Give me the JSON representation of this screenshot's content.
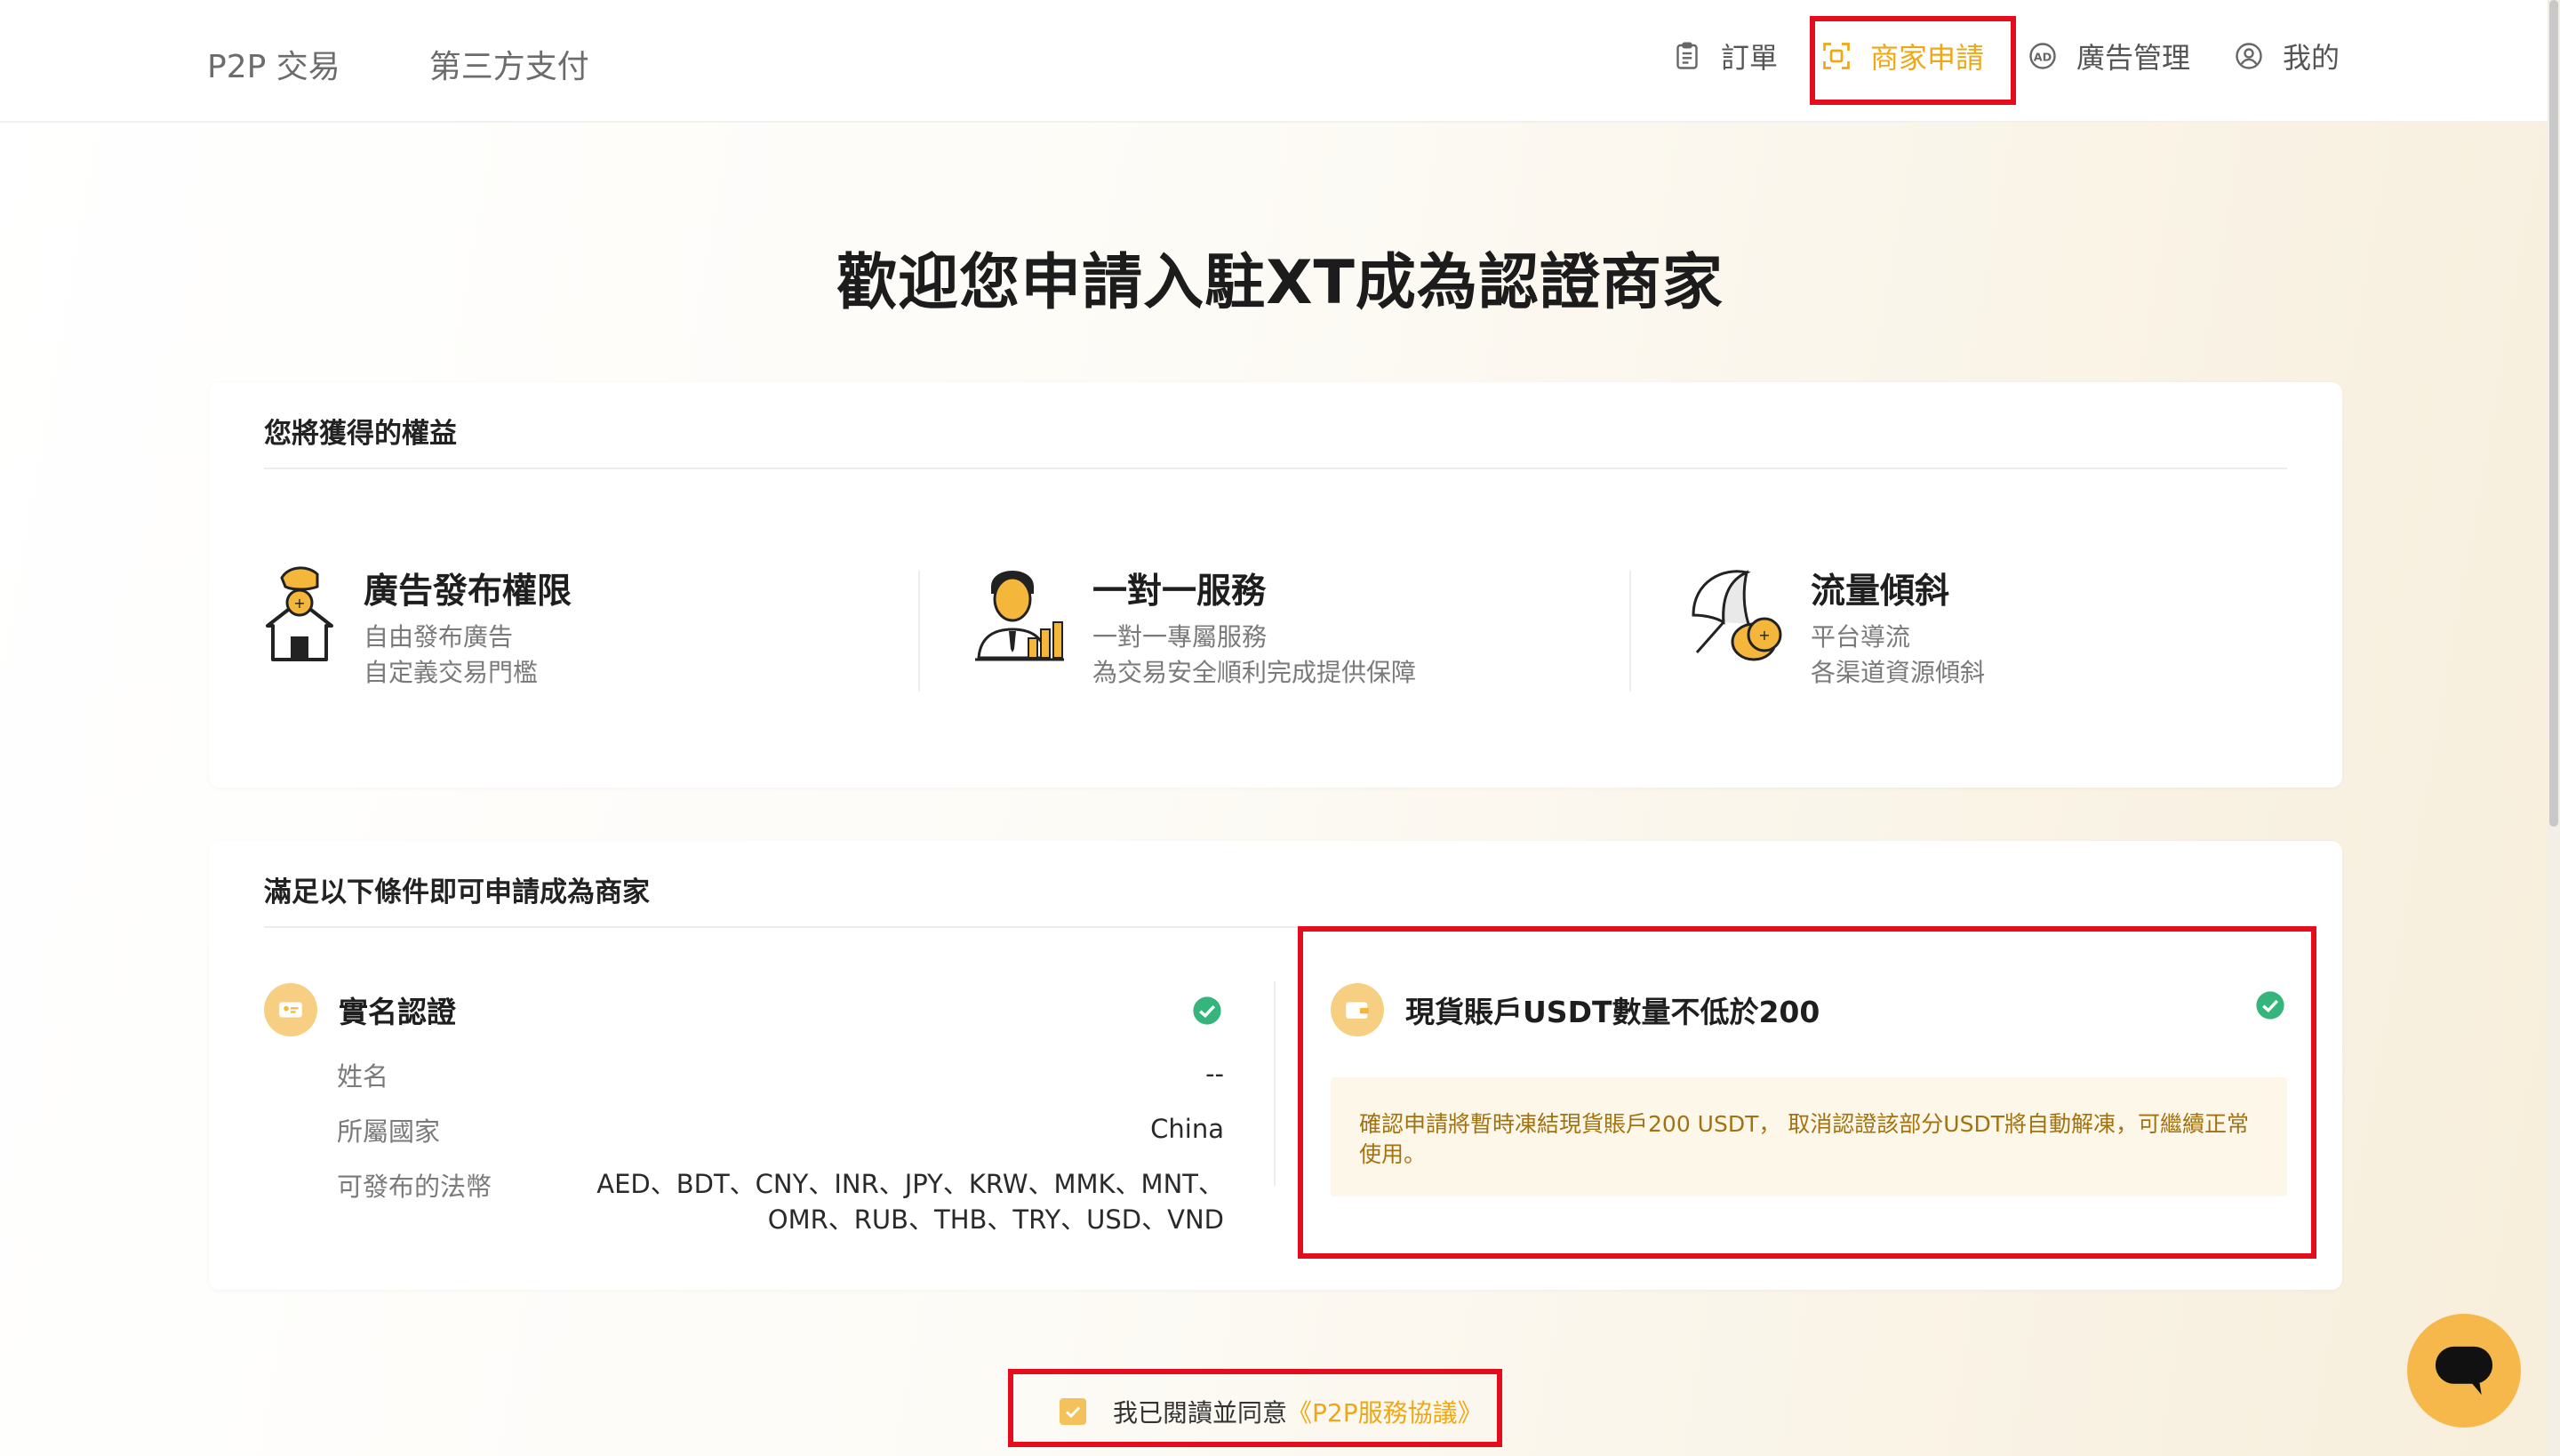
{
  "header": {
    "nav_left": [
      "P2P 交易",
      "第三方支付"
    ],
    "nav_right": [
      {
        "label": "訂單",
        "icon": "clipboard-icon"
      },
      {
        "label": "商家申請",
        "icon": "merchant-icon",
        "active": true
      },
      {
        "label": "廣告管理",
        "icon": "ad-icon"
      },
      {
        "label": "我的",
        "icon": "user-icon"
      }
    ],
    "accent_color": "#f0a714"
  },
  "page_title": "歡迎您申請入駐XT成為認證商家",
  "benefits": {
    "title": "您將獲得的權益",
    "items": [
      {
        "title": "廣告發布權限",
        "lines": [
          "自由發布廣告",
          "自定義交易門檻"
        ],
        "icon": "house-hand-icon"
      },
      {
        "title": "一對一服務",
        "lines": [
          "一對一專屬服務",
          "為交易安全順利完成提供保障"
        ],
        "icon": "agent-icon"
      },
      {
        "title": "流量傾斜",
        "lines": [
          "平台導流",
          "各渠道資源傾斜"
        ],
        "icon": "umbrella-coin-icon"
      }
    ]
  },
  "conditions": {
    "title": "滿足以下條件即可申請成為商家",
    "kyc": {
      "title": "實名認證",
      "rows": [
        {
          "label": "姓名",
          "value": "--"
        },
        {
          "label": "所屬國家",
          "value": "China"
        },
        {
          "label": "可發布的法幣",
          "value_lines": [
            "AED、BDT、CNY、INR、JPY、KRW、MMK、MNT、",
            "OMR、RUB、THB、TRY、USD、VND"
          ]
        }
      ]
    },
    "balance": {
      "title": "現貨賬戶USDT數量不低於200",
      "note": "確認申請將暫時凍結現貨賬戶200 USDT， 取消認證該部分USDT將自動解凍，可繼續正常使用。"
    }
  },
  "agreement": {
    "text": "我已閱讀並同意",
    "link": "《P2P服務協議》",
    "checked": true
  },
  "colors": {
    "highlight_red": "#e50c1e",
    "check_green": "#35b57c",
    "chat_button": "#f6b84b"
  }
}
